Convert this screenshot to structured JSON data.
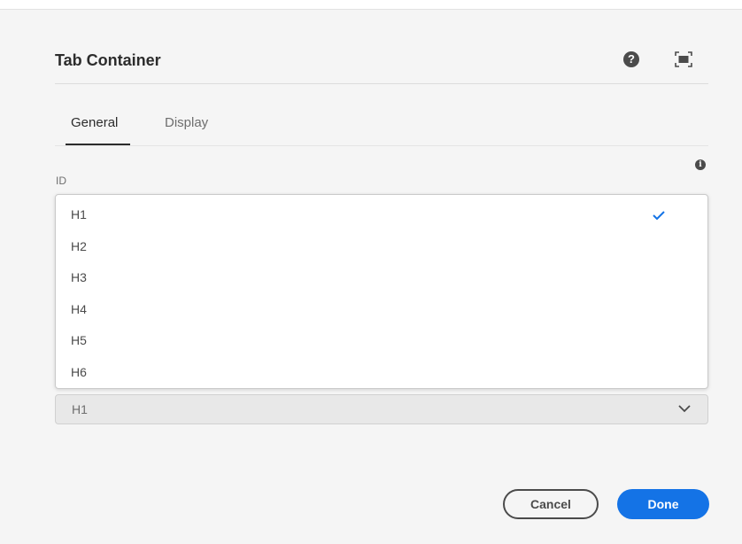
{
  "dialog": {
    "title": "Tab Container",
    "icons": {
      "help": "help-icon",
      "fullscreen": "fullscreen-icon"
    }
  },
  "tabs": [
    {
      "label": "General",
      "selected": true
    },
    {
      "label": "Display",
      "selected": false
    }
  ],
  "field": {
    "label": "ID",
    "info_icon": "info-icon",
    "info_glyph": "i",
    "value": "H1",
    "options": [
      "H1",
      "H2",
      "H3",
      "H4",
      "H5",
      "H6"
    ],
    "selected_option": "H1"
  },
  "footer": {
    "cancel_label": "Cancel",
    "done_label": "Done"
  },
  "colors": {
    "accent": "#1473e6",
    "background": "#f5f5f5"
  }
}
